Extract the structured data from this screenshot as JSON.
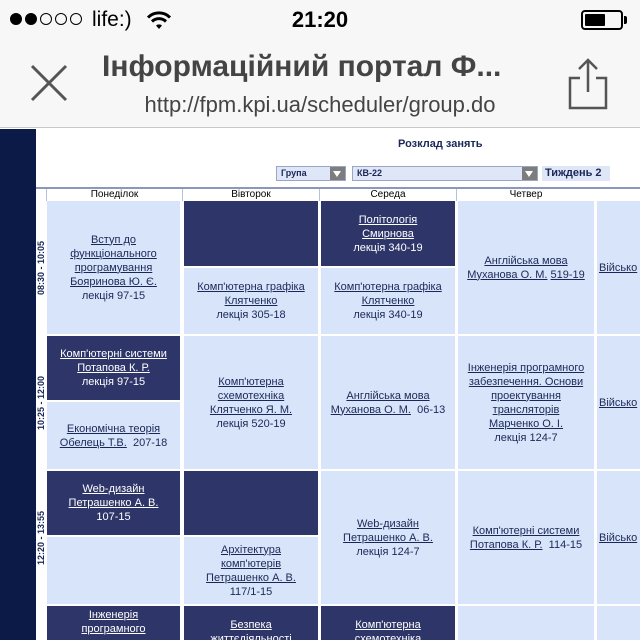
{
  "status_bar": {
    "carrier": "life:)",
    "time": "21:20"
  },
  "browser": {
    "title": "Інформаційний портал Ф...",
    "url": "http://fpm.kpi.ua/scheduler/group.do"
  },
  "page": {
    "schedule_title": "Розклад занять",
    "group_label": "Група",
    "group_value": "КВ-22",
    "week_label": "Тиждень 2",
    "days": [
      "Понеділок",
      "Вівторок",
      "Середа",
      "Четвер"
    ],
    "times": [
      "08:30 - 10:05",
      "10:25 - 12:00",
      "12:20 - 13:55"
    ],
    "cells": {
      "r1_mon": {
        "subject": "Вступ до функціонального програмування",
        "teacher": "Бояринова Ю. Є.",
        "room": "лекція 97-15"
      },
      "r1_tue_b": {
        "subject": "Комп'ютерна графіка",
        "teacher": "Клятченко",
        "room": "лекція 305-18"
      },
      "r1_wed_a": {
        "subject": "Політологія",
        "teacher": "Смирнова",
        "room": "лекція 340-19"
      },
      "r1_wed_b": {
        "subject": "Комп'ютерна графіка",
        "teacher": "Клятченко",
        "room": "лекція 340-19"
      },
      "r1_thu": {
        "subject": "Англійська мова",
        "teacher": "Муханова О. М.",
        "room": "519-19"
      },
      "r1_fri": {
        "subject": "Військо"
      },
      "r2_mon_a": {
        "subject": "Комп'ютерні системи",
        "teacher": "Потапова К. Р.",
        "room": "лекція 97-15"
      },
      "r2_mon_b": {
        "subject": "Економічна теорія",
        "teacher": "Обелець Т.В.",
        "room": "207-18"
      },
      "r2_tue": {
        "subject": "Комп'ютерна схемотехніка",
        "teacher": "Клятченко Я. М.",
        "room": "лекція 520-19"
      },
      "r2_wed": {
        "subject": "Англійська мова",
        "teacher": "Муханова О. М.",
        "room": "06-13"
      },
      "r2_thu": {
        "subject": "Інженерія програмного забезпечення. Основи проектування трансляторів",
        "teacher": "Марченко О. І.",
        "room": "лекція 124-7"
      },
      "r2_fri": {
        "subject": "Військо"
      },
      "r3_mon": {
        "subject": "Web-дизайн",
        "teacher": "Петрашенко А. В.",
        "room": "107-15"
      },
      "r3_tue_b": {
        "subject": "Архітектура комп'ютерів",
        "teacher": "Петрашенко А. В.",
        "room": "117/1-15"
      },
      "r3_wed": {
        "subject": "Web-дизайн",
        "teacher": "Петрашенко А. В.",
        "room": "лекція 124-7"
      },
      "r3_thu": {
        "subject": "Комп'ютерні системи",
        "teacher": "Потапова К. Р.",
        "room": "114-15"
      },
      "r3_fri": {
        "subject": "Військо"
      },
      "r4_mon": {
        "subject": "Інженерія програмного"
      },
      "r4_tue": {
        "subject": "Безпека життєдіяльності"
      },
      "r4_wed": {
        "subject": "Комп'ютерна схемотехніка"
      }
    }
  },
  "colors": {
    "dark_cell": "#2e3569",
    "light_cell": "#d8e4fa",
    "left_strip": "#0c1a48",
    "text_dark": "#1b2857"
  }
}
